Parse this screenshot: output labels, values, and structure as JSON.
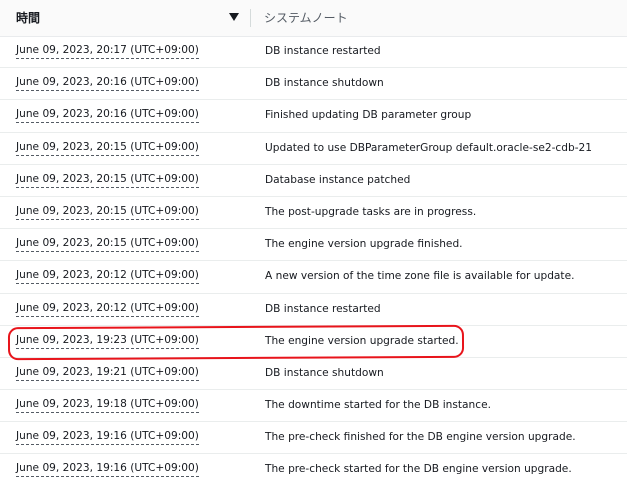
{
  "header": {
    "time_label": "時間",
    "note_label": "システムノート"
  },
  "rows": [
    {
      "time": "June 09, 2023, 20:17 (UTC+09:00)",
      "note": "DB instance restarted"
    },
    {
      "time": "June 09, 2023, 20:16 (UTC+09:00)",
      "note": "DB instance shutdown"
    },
    {
      "time": "June 09, 2023, 20:16 (UTC+09:00)",
      "note": "Finished updating DB parameter group"
    },
    {
      "time": "June 09, 2023, 20:15 (UTC+09:00)",
      "note": "Updated to use DBParameterGroup default.oracle-se2-cdb-21"
    },
    {
      "time": "June 09, 2023, 20:15 (UTC+09:00)",
      "note": "Database instance patched"
    },
    {
      "time": "June 09, 2023, 20:15 (UTC+09:00)",
      "note": "The post-upgrade tasks are in progress."
    },
    {
      "time": "June 09, 2023, 20:15 (UTC+09:00)",
      "note": "The engine version upgrade finished."
    },
    {
      "time": "June 09, 2023, 20:12 (UTC+09:00)",
      "note": "A new version of the time zone file is available for update."
    },
    {
      "time": "June 09, 2023, 20:12 (UTC+09:00)",
      "note": "DB instance restarted"
    },
    {
      "time": "June 09, 2023, 19:23 (UTC+09:00)",
      "note": "The engine version upgrade started."
    },
    {
      "time": "June 09, 2023, 19:21 (UTC+09:00)",
      "note": "DB instance shutdown"
    },
    {
      "time": "June 09, 2023, 19:18 (UTC+09:00)",
      "note": "The downtime started for the DB instance."
    },
    {
      "time": "June 09, 2023, 19:16 (UTC+09:00)",
      "note": "The pre-check finished for the DB engine version upgrade."
    },
    {
      "time": "June 09, 2023, 19:16 (UTC+09:00)",
      "note": "The pre-check started for the DB engine version upgrade."
    }
  ],
  "colors": {
    "highlight": "#e8141b"
  }
}
